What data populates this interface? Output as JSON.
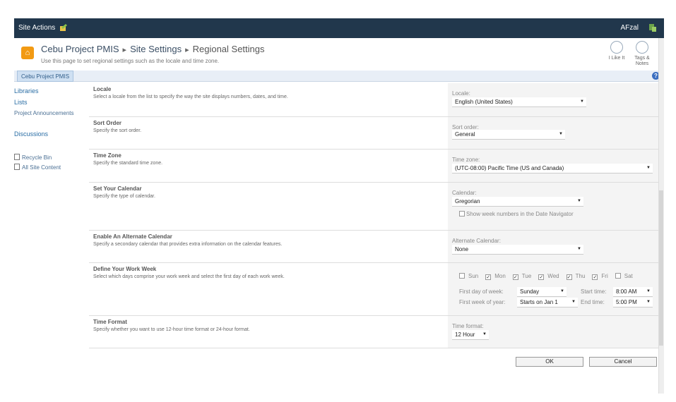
{
  "topbar": {
    "site_actions": "Site Actions",
    "user": "AFzal"
  },
  "header": {
    "breadcrumb": [
      "Cebu Project PMIS",
      "Site Settings",
      "Regional Settings"
    ],
    "description": "Use this page to set regional settings such as the locale and time zone.",
    "i_like_it": "I Like It",
    "tags_notes": "Tags & Notes"
  },
  "navbar": {
    "home_tab": "Cebu Project PMIS",
    "help": "?"
  },
  "leftnav": {
    "libraries": "Libraries",
    "lists": "Lists",
    "project_announcements": "Project Announcements",
    "discussions": "Discussions",
    "recycle_bin": "Recycle Bin",
    "all_site_content": "All Site Content"
  },
  "sections": {
    "locale": {
      "title": "Locale",
      "desc": "Select a locale from the list to specify the way the site displays numbers, dates, and time.",
      "label": "Locale:",
      "value": "English (United States)"
    },
    "sort": {
      "title": "Sort Order",
      "desc": "Specify the sort order.",
      "label": "Sort order:",
      "value": "General"
    },
    "timezone": {
      "title": "Time Zone",
      "desc": "Specify the standard time zone.",
      "label": "Time zone:",
      "value": "(UTC-08:00) Pacific Time (US and Canada)"
    },
    "calendar": {
      "title": "Set Your Calendar",
      "desc": "Specify the type of calendar.",
      "label": "Calendar:",
      "value": "Gregorian",
      "week_numbers": "Show week numbers in the Date Navigator"
    },
    "alt_calendar": {
      "title": "Enable An Alternate Calendar",
      "desc": "Specify a secondary calendar that provides extra information on the calendar features.",
      "label": "Alternate Calendar:",
      "value": "None"
    },
    "work_week": {
      "title": "Define Your Work Week",
      "desc": "Select which days comprise your work week and select the first day of each work week.",
      "days": [
        {
          "label": "Sun",
          "checked": false
        },
        {
          "label": "Mon",
          "checked": true
        },
        {
          "label": "Tue",
          "checked": true
        },
        {
          "label": "Wed",
          "checked": true
        },
        {
          "label": "Thu",
          "checked": true
        },
        {
          "label": "Fri",
          "checked": true
        },
        {
          "label": "Sat",
          "checked": false
        }
      ],
      "first_day_label": "First day of week:",
      "first_day_value": "Sunday",
      "start_time_label": "Start time:",
      "start_time_value": "8:00 AM",
      "first_week_label": "First week of year:",
      "first_week_value": "Starts on Jan 1",
      "end_time_label": "End time:",
      "end_time_value": "5:00 PM"
    },
    "time_format": {
      "title": "Time Format",
      "desc": "Specify whether you want to use 12-hour time format or 24-hour format.",
      "label": "Time format:",
      "value": "12 Hour"
    }
  },
  "buttons": {
    "ok": "OK",
    "cancel": "Cancel"
  },
  "colors": {
    "topbar": "#21374c",
    "link": "#2a6ea5",
    "site_logo": "#f29a13"
  }
}
